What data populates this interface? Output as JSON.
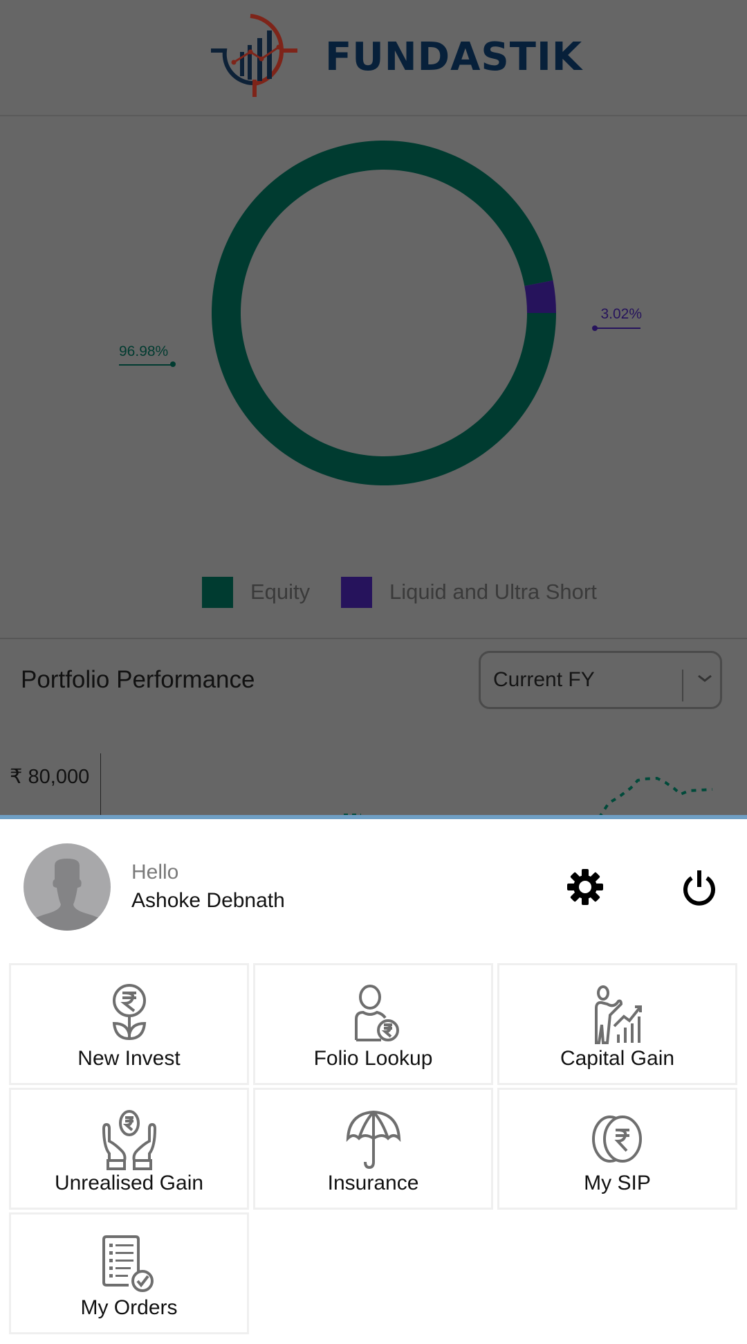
{
  "app": {
    "brand": "FUNDASTIK",
    "logo_icon": "chart-target-logo-icon",
    "colors": {
      "overlay": "#666666",
      "brand_navy": "#07203a",
      "brand_red": "#9a2a1e",
      "equity": "#003b30",
      "liquid": "#26135c",
      "sheet_top_bar": "#6f9fc4",
      "icon_gray": "#6e6e6e"
    }
  },
  "chart_data": [
    {
      "type": "pie",
      "title": "",
      "donut": true,
      "categories": [
        "Equity",
        "Liquid and Ultra Short"
      ],
      "values": [
        96.98,
        3.02
      ],
      "data_labels": [
        "96.98%",
        "3.02%"
      ],
      "colors": [
        "#003b30",
        "#26135c"
      ],
      "legend": [
        "Equity",
        "Liquid and Ultra Short"
      ],
      "legend_position": "bottom"
    },
    {
      "type": "line",
      "title": "Portfolio Performance",
      "ylabel": "",
      "y_ticks": [
        "₹ 80,000"
      ],
      "series_style": "dotted",
      "partially_visible": true
    }
  ],
  "portfolio_performance": {
    "title": "Portfolio Performance",
    "period_select": {
      "value": "Current FY",
      "icon": "chevron-down-icon"
    },
    "y_tick": "₹ 80,000"
  },
  "profile": {
    "greeting": "Hello",
    "name": "Ashoke Debnath",
    "avatar_icon": "user-silhouette-icon",
    "settings_icon": "gear-icon",
    "logout_icon": "power-icon"
  },
  "menu": {
    "items": [
      {
        "label": "New Invest",
        "icon": "rupee-plant-icon"
      },
      {
        "label": "Folio Lookup",
        "icon": "user-rupee-icon"
      },
      {
        "label": "Capital Gain",
        "icon": "presenter-growth-chart-icon"
      },
      {
        "label": "Unrealised Gain",
        "icon": "hands-rupee-icon"
      },
      {
        "label": "Insurance",
        "icon": "umbrella-icon"
      },
      {
        "label": "My SIP",
        "icon": "rupee-coins-icon"
      },
      {
        "label": "My Orders",
        "icon": "checklist-icon"
      }
    ]
  }
}
